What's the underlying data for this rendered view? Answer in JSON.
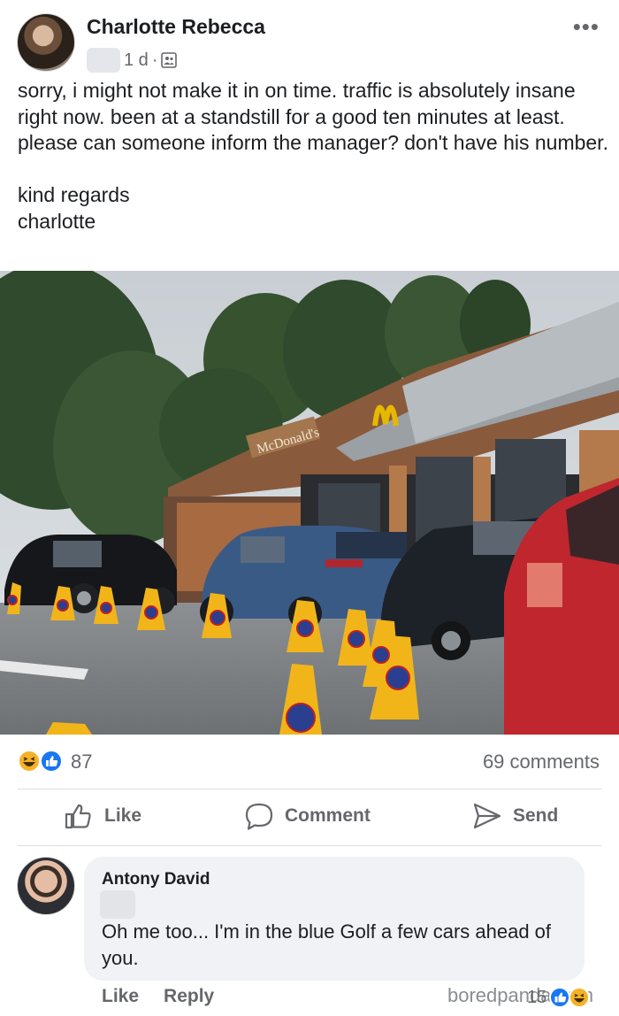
{
  "post": {
    "author": "Charlotte Rebecca",
    "time": "1 d",
    "separator": "·",
    "more": "•••",
    "text": "sorry, i might not make it in on time. traffic is absolutely insane right now. been at a standstill for a good ten minutes at least. please can someone inform the manager? don't have his number.\n\nkind regards\ncharlotte",
    "photo_sign": "McDonald's",
    "reactions": [
      "haha-icon",
      "like-icon"
    ],
    "reaction_count": "87",
    "comment_count": "69 comments"
  },
  "actions": {
    "like": "Like",
    "comment": "Comment",
    "send": "Send"
  },
  "comment": {
    "author": "Antony David",
    "text": "Oh me too... I'm in the blue Golf a few cars ahead of you.",
    "like": "Like",
    "reply": "Reply",
    "reaction_count": "15",
    "reactions": [
      "like-icon",
      "haha-icon"
    ]
  },
  "watermark": "boredpanda.com",
  "colors": {
    "text": "#1c1e21",
    "secondary": "#65676b",
    "like_blue": "#1877f2",
    "haha_yellow": "#f7b125",
    "bubble": "#f0f2f5"
  }
}
